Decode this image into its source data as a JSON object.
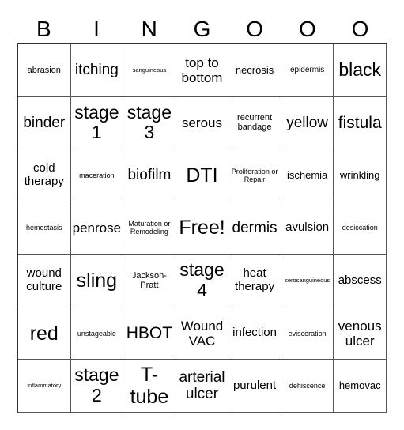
{
  "header": {
    "letters": [
      "B",
      "I",
      "N",
      "G",
      "O",
      "O",
      "O"
    ]
  },
  "board": {
    "rows": [
      [
        "abrasion",
        "itching",
        "sanguineous",
        "top to bottom",
        "necrosis",
        "epidermis",
        "black"
      ],
      [
        "binder",
        "stage 1",
        "stage 3",
        "serous",
        "recurrent bandage",
        "yellow",
        "fistula"
      ],
      [
        "cold therapy",
        "maceration",
        "biofilm",
        "DTI",
        "Proliferation or Repair",
        "ischemia",
        "wrinkling"
      ],
      [
        "hemostasis",
        "penrose",
        "Maturation or Remodeling",
        "Free!",
        "dermis",
        "avulsion",
        "desiccation"
      ],
      [
        "wound culture",
        "sling",
        "Jackson-Pratt",
        "stage 4",
        "heat therapy",
        "serosanguineous",
        "abscess"
      ],
      [
        "red",
        "unstageable",
        "HBOT",
        "Wound VAC",
        "infection",
        "evisceration",
        "venous ulcer"
      ],
      [
        "inflammatory",
        "stage 2",
        "T-tube",
        "arterial ulcer",
        "purulent",
        "dehiscence",
        "hemovac"
      ]
    ]
  }
}
